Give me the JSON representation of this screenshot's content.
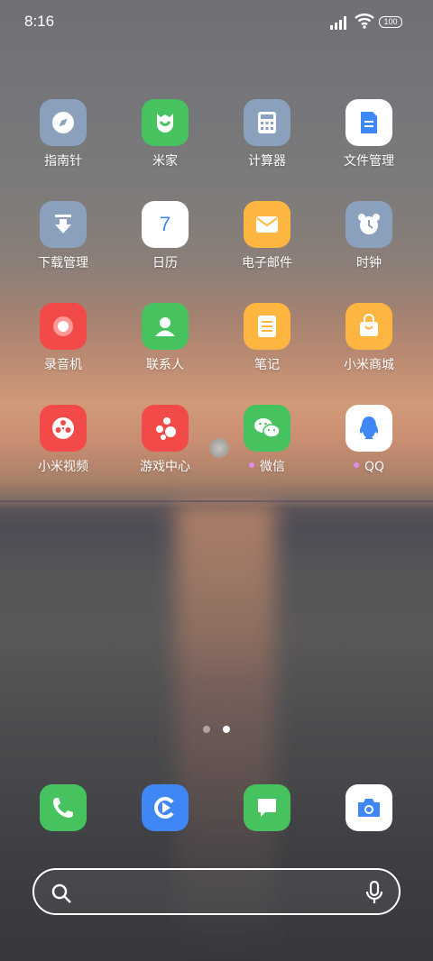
{
  "status_bar": {
    "time": "8:16",
    "battery": "100"
  },
  "apps": [
    {
      "label": "指南针",
      "icon": "compass-icon",
      "color": "#8aa0bc"
    },
    {
      "label": "米家",
      "icon": "mijia-icon",
      "color": "#46c35f"
    },
    {
      "label": "计算器",
      "icon": "calculator-icon",
      "color": "#8aa0bc"
    },
    {
      "label": "文件管理",
      "icon": "file-manager-icon",
      "color": "#ffffff"
    },
    {
      "label": "下载管理",
      "icon": "download-icon",
      "color": "#8aa0bc"
    },
    {
      "label": "日历",
      "icon": "calendar-icon",
      "color": "#ffffff",
      "day": "7"
    },
    {
      "label": "电子邮件",
      "icon": "mail-icon",
      "color": "#ffb640"
    },
    {
      "label": "时钟",
      "icon": "alarm-clock-icon",
      "color": "#8aa0bc"
    },
    {
      "label": "录音机",
      "icon": "recorder-icon",
      "color": "#f24a48"
    },
    {
      "label": "联系人",
      "icon": "contacts-icon",
      "color": "#46c35f"
    },
    {
      "label": "笔记",
      "icon": "notes-icon",
      "color": "#ffb640"
    },
    {
      "label": "小米商城",
      "icon": "shopping-bag-icon",
      "color": "#ffb640"
    },
    {
      "label": "小米视频",
      "icon": "video-reel-icon",
      "color": "#f24a48"
    },
    {
      "label": "游戏中心",
      "icon": "game-center-icon",
      "color": "#f24a48"
    },
    {
      "label": "微信",
      "icon": "wechat-icon",
      "color": "#46c35f",
      "new_dot": true
    },
    {
      "label": "QQ",
      "icon": "qq-penguin-icon",
      "color": "#ffffff",
      "new_dot": true
    }
  ],
  "page_indicator": {
    "total": 2,
    "active": 2
  },
  "dock": [
    {
      "icon": "phone-icon",
      "color": "#46c35f"
    },
    {
      "icon": "browser-icon",
      "color": "#3f87f5"
    },
    {
      "icon": "messages-icon",
      "color": "#46c35f"
    },
    {
      "icon": "camera-icon",
      "color": "#ffffff"
    }
  ],
  "search": {
    "placeholder": ""
  }
}
